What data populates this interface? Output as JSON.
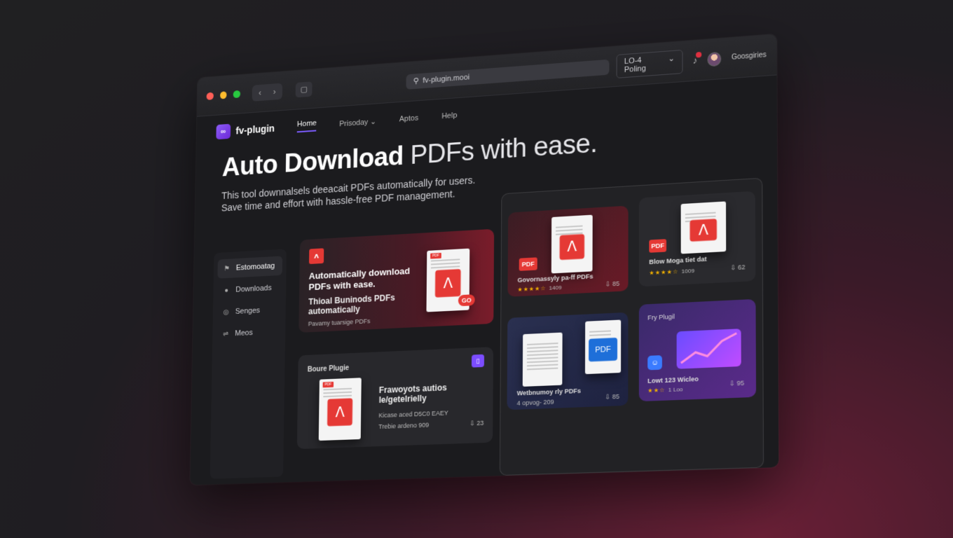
{
  "browser": {
    "url": "fv-plugin.mooi",
    "dropdown": "LO-4 Poling",
    "user_name": "Goosgiries"
  },
  "nav": {
    "brand": "fv-plugin",
    "links": [
      "Home",
      "Prisoday",
      "Aptos",
      "Help"
    ]
  },
  "hero": {
    "title_bold": "Auto Download",
    "title_light": "PDFs with ease.",
    "line1": "This tool downnalsels deeacait PDFs automatically for users.",
    "line2": "Save time and effort with hassle-free PDF management."
  },
  "sidebar": {
    "items": [
      "Estomoatag",
      "Downloads",
      "Senges",
      "Meos"
    ]
  },
  "cards": {
    "main": {
      "title": "Automatically download PDFs with ease.",
      "sub": "Thioal Buninods PDFs automatically",
      "caption": "Pavamy tuarsige PDFs",
      "badge": "GO",
      "doc_tag": "PDF"
    },
    "plugin": {
      "label": "Boure Plugie",
      "title": "Frawoyots autios le/getelrielly",
      "line1": "Kicase aced D5C0 EAEY",
      "line2": "Trebie ardeno 909",
      "meta": "23",
      "doc_tag": "PDF"
    },
    "gov": {
      "title": "Govornassyly pa-ff PDFs",
      "rating": "1409",
      "meta": "85",
      "badge": "PDF"
    },
    "blog": {
      "title": "Blow Moga tiet dat",
      "rating": "1009",
      "meta": "62",
      "badge": "PDF"
    },
    "web": {
      "title": "Wetbnumoy rly PDFs",
      "rating": "4 opvog- 209",
      "meta": "85",
      "badge": "PDF"
    },
    "fv": {
      "label": "Fry Plugil",
      "title": "Lowt 123 Wicleo",
      "rating": "1 Loo",
      "meta": "95"
    }
  },
  "colors": {
    "accent": "#7c5cff",
    "pdf_red": "#e53935",
    "star": "#f5b301"
  },
  "icons": {
    "star": "★",
    "chevron": "⌄",
    "lock": "🔒",
    "bell": "🔔"
  }
}
